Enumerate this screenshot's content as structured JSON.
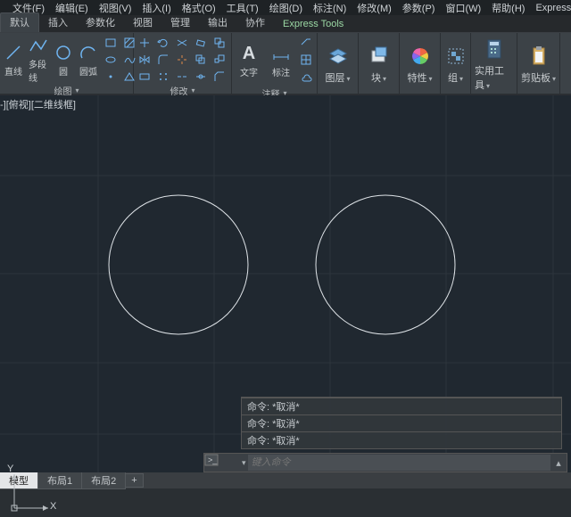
{
  "menubar": [
    "文件(F)",
    "编辑(E)",
    "视图(V)",
    "插入(I)",
    "格式(O)",
    "工具(T)",
    "绘图(D)",
    "标注(N)",
    "修改(M)",
    "参数(P)",
    "窗口(W)",
    "帮助(H)",
    "Express"
  ],
  "ribbonTabs": {
    "active": "默认",
    "items": [
      "默认",
      "插入",
      "参数化",
      "视图",
      "管理",
      "输出",
      "协作",
      "Express Tools"
    ]
  },
  "draw": {
    "title": "绘图",
    "line": "直线",
    "polyline": "多段线",
    "circle": "圆",
    "arc": "圆弧"
  },
  "modify": {
    "title": "修改"
  },
  "annot": {
    "title": "注释",
    "text": "文字",
    "dim": "标注"
  },
  "panels": {
    "layer": "图层",
    "block": "块",
    "prop": "特性",
    "group": "组",
    "util": "实用工具",
    "clip": "剪贴板"
  },
  "viewLabel": "-][俯视][二维线框]",
  "ucs": {
    "x": "X",
    "y": "Y"
  },
  "history": {
    "l1": "命令: *取消*",
    "l2": "命令: *取消*",
    "l3": "命令: *取消*"
  },
  "cmdline": {
    "close": "×",
    "dd": "▾",
    "placeholder": "键入命令",
    "chev": "▴"
  },
  "statusTabs": {
    "model": "模型",
    "l1": "布局1",
    "l2": "布局2",
    "plus": "+"
  },
  "dd": "▾"
}
